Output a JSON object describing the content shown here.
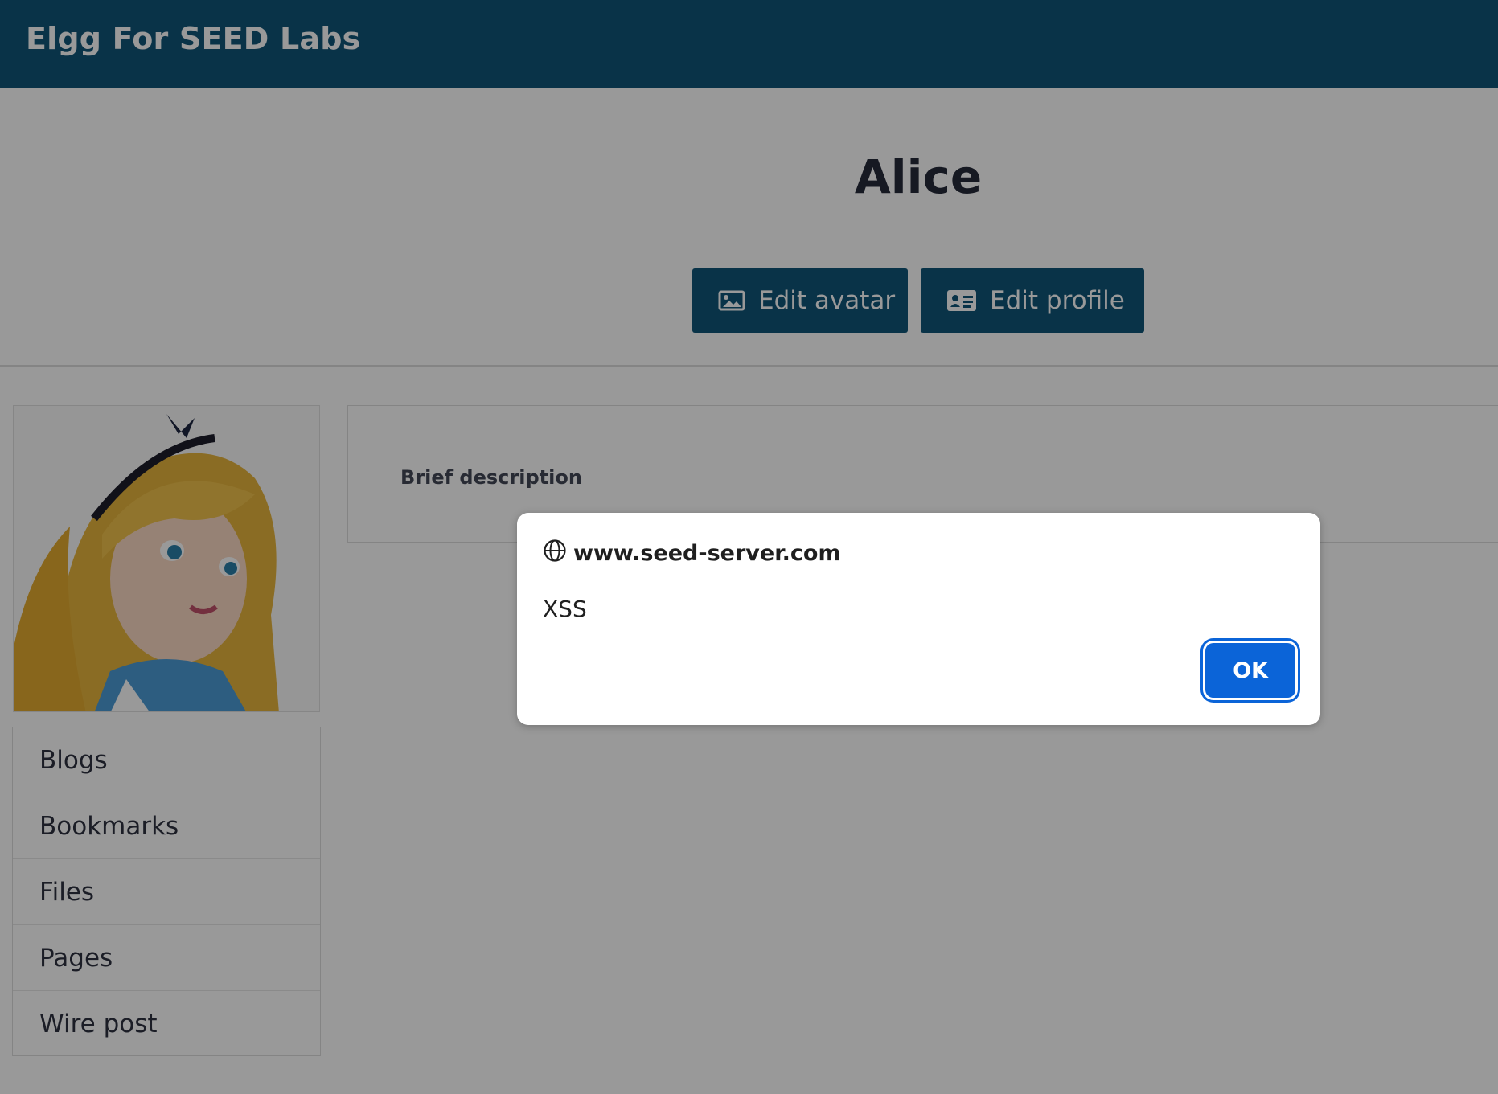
{
  "header": {
    "site_title": "Elgg For SEED Labs"
  },
  "profile": {
    "name": "Alice",
    "edit_avatar_label": "Edit avatar",
    "edit_profile_label": "Edit profile",
    "details_label": "Brief description"
  },
  "sidebar": {
    "items": [
      {
        "label": "Blogs"
      },
      {
        "label": "Bookmarks"
      },
      {
        "label": "Files"
      },
      {
        "label": "Pages"
      },
      {
        "label": "Wire post"
      }
    ]
  },
  "dialog": {
    "origin": "www.seed-server.com",
    "message": "XSS",
    "ok_label": "OK"
  },
  "colors": {
    "brand": "#0f5578",
    "dialog_button": "#0b64d8"
  },
  "icons": [
    "image-icon",
    "id-card-icon",
    "globe-icon"
  ]
}
